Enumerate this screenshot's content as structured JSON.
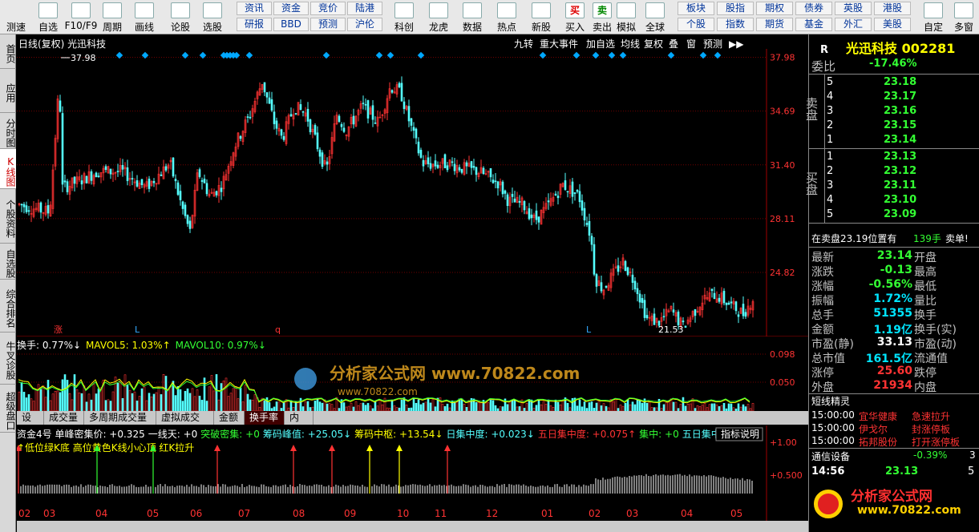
{
  "toolbar": {
    "items": [
      {
        "label": "测速",
        "icon": "speed-icon"
      },
      {
        "label": "自选",
        "icon": "star-icon"
      },
      {
        "label": "F10/F9",
        "icon": "info-icon"
      },
      {
        "label": "周期",
        "icon": "clock-icon"
      },
      {
        "label": "画线",
        "icon": "pencil-icon"
      },
      {
        "label": "论股",
        "icon": "discuss-icon"
      },
      {
        "label": "选股",
        "icon": "stock-pick-icon"
      }
    ],
    "mid_buttons": [
      [
        "资讯",
        "资金",
        "竞价",
        "陆港"
      ],
      [
        "研报",
        "BBD",
        "预测",
        "沪伦"
      ]
    ],
    "right_items": [
      {
        "label": "科创",
        "icon": "chart-icon"
      },
      {
        "label": "龙虎",
        "icon": "dragon-icon"
      },
      {
        "label": "数据",
        "icon": "pe-icon"
      },
      {
        "label": "热点",
        "icon": "hot-icon"
      },
      {
        "label": "新股",
        "icon": "new-stock-icon"
      },
      {
        "label": "买入",
        "icon": "buy-icon",
        "glyph": "买"
      },
      {
        "label": "卖出",
        "icon": "sell-icon",
        "glyph": "卖"
      },
      {
        "label": "模拟",
        "icon": "hammer-icon"
      },
      {
        "label": "全球",
        "icon": "globe-icon"
      }
    ],
    "market_buttons": [
      [
        "板块",
        "股指",
        "期权",
        "债券",
        "英股",
        "港股"
      ],
      [
        "个股",
        "指数",
        "期货",
        "基金",
        "外汇",
        "美股"
      ]
    ],
    "tail_items": [
      {
        "label": "自定",
        "icon": "custom-icon"
      },
      {
        "label": "多窗",
        "icon": "multi-window-icon"
      }
    ]
  },
  "left_tabs": [
    "首页",
    "应用",
    "分时图",
    "K线图",
    "个股资料",
    "自选股",
    "综合排名",
    "牛叉诊股",
    "超级盘口"
  ],
  "chart": {
    "title": "日线(复权) 光迅科技",
    "top_buttons": [
      "九转",
      "重大事件",
      "加自选",
      "均线",
      "复权",
      "叠",
      "窗",
      "预测"
    ],
    "price_labels": [
      "37.98",
      "34.69",
      "31.40",
      "28.11",
      "24.82"
    ],
    "max_label": "37.98",
    "min_label": "21.53",
    "markers": [
      "涨",
      "L",
      "q",
      "L"
    ],
    "vol_title": "换手: 0.77%↓ MAVOL5: 1.03%↑ MAVOL10: 0.97%↓",
    "vol_title_parts": {
      "a": "换手: 0.77%↓",
      "b": "MAVOL5: 1.03%↑",
      "c": "MAVOL10: 0.97%↓"
    },
    "vol_labels": [
      "0.098",
      "0.050"
    ],
    "watermark": "分析家公式网 www.70822.com",
    "watermark_small": "www.70822.com"
  },
  "bottom_tabs": [
    "设置",
    "成交量",
    "多周期成交量",
    "虚拟成交量",
    "金额",
    "换手率",
    "内盘"
  ],
  "indicator": {
    "title_parts": [
      "资金4号 单峰密集价: +0.325",
      "一线天: +0",
      "突破密集: +0",
      "筹码峰值: +25.05↓",
      "筹码中枢: +13.54↓",
      "日集中度: +0.023↓",
      "五日集中度: +0.075↑",
      "集中: +0",
      "五日集中: +0"
    ],
    "subtitle": "↑低位绿K底 高位黄色K线小心顶 红K拉升",
    "help_button": "指标说明",
    "labels": [
      "+1.00",
      "+0.500"
    ]
  },
  "x_axis": [
    "02",
    "03",
    "04",
    "05",
    "06",
    "07",
    "08",
    "09",
    "10",
    "11",
    "12",
    "01",
    "02",
    "03",
    "04",
    "05"
  ],
  "quote": {
    "code_letter": "R",
    "name_code": "光迅科技 002281",
    "weibi_label": "委比",
    "weibi": "-17.46%",
    "sell_label": "卖盘",
    "buy_label": "买盘",
    "sell": [
      {
        "n": "5",
        "p": "23.18"
      },
      {
        "n": "4",
        "p": "23.17"
      },
      {
        "n": "3",
        "p": "23.16"
      },
      {
        "n": "2",
        "p": "23.15"
      },
      {
        "n": "1",
        "p": "23.14"
      }
    ],
    "buy": [
      {
        "n": "1",
        "p": "23.13"
      },
      {
        "n": "2",
        "p": "23.12"
      },
      {
        "n": "3",
        "p": "23.11"
      },
      {
        "n": "4",
        "p": "23.10"
      },
      {
        "n": "5",
        "p": "23.09"
      }
    ],
    "notice": {
      "a": "在卖盘23.19位置有",
      "b": "139手",
      "c": "卖单!"
    },
    "stats": [
      {
        "l": "最新",
        "v": "23.14",
        "c": "green",
        "l2": "开盘"
      },
      {
        "l": "涨跌",
        "v": "-0.13",
        "c": "green",
        "l2": "最高"
      },
      {
        "l": "涨幅",
        "v": "-0.56%",
        "c": "green",
        "l2": "最低"
      },
      {
        "l": "振幅",
        "v": "1.72%",
        "c": "cyan",
        "l2": "量比"
      },
      {
        "l": "总手",
        "v": "51355",
        "c": "cyan",
        "l2": "换手"
      },
      {
        "l": "金额",
        "v": "1.19亿",
        "c": "cyan",
        "l2": "换手(实)"
      },
      {
        "l": "市盈(静)",
        "v": "33.13",
        "c": "white",
        "l2": "市盈(动)"
      },
      {
        "l": "总市值",
        "v": "161.5亿",
        "c": "cyan",
        "l2": "流通值"
      },
      {
        "l": "涨停",
        "v": "25.60",
        "c": "red",
        "l2": "跌停"
      },
      {
        "l": "外盘",
        "v": "21934",
        "c": "red",
        "l2": "内盘"
      }
    ],
    "news_title": "短线精灵",
    "news": [
      {
        "t": "15:00:00",
        "s": "宜华健康",
        "e": "急速拉升"
      },
      {
        "t": "15:00:00",
        "s": "伊戈尔",
        "e": "封涨停板"
      },
      {
        "t": "15:00:00",
        "s": "拓邦股份",
        "e": "打开涨停板"
      }
    ],
    "sector": {
      "name": "通信设备",
      "pct": "-0.39%",
      "n": "3"
    },
    "tick": {
      "time": "14:56",
      "price": "23.13",
      "vol": "5"
    },
    "logo": "分析家公式网",
    "logo_url": "www.70822.com"
  },
  "colors": {
    "up": "#ff3333",
    "down": "#54ffff",
    "grid": "#8b0000"
  }
}
